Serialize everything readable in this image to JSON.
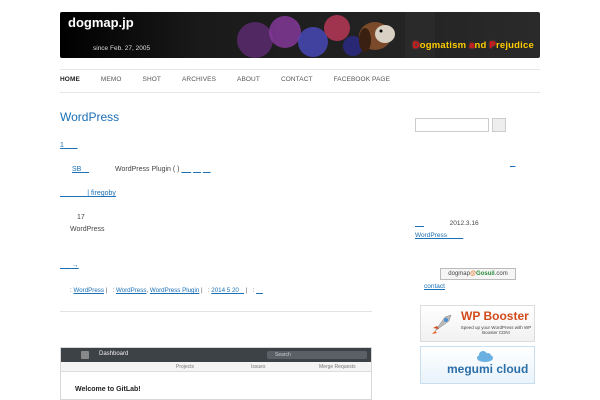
{
  "header": {
    "site_title": "dogmap.jp",
    "since": "since Feb. 27, 2005",
    "tagline_parts": [
      "D",
      "ogmatism ",
      "a",
      "nd ",
      "P",
      "rejudice"
    ]
  },
  "nav": {
    "items": [
      "HOME",
      "MEMO",
      "SHOT",
      "ARCHIVES",
      "ABOUT",
      "CONTACT",
      "FACEBOOK PAGE"
    ]
  },
  "post": {
    "title": "WordPress",
    "link1": "1",
    "sb_link": "SB",
    "plugin_text": "WordPress Plugin  (     )",
    "author_link": "| firegoby",
    "number": "17",
    "wp_text": "WordPress",
    "more_link": "→",
    "meta": {
      "label_prefix": ":",
      "cat1": "WordPress",
      "sep": "|",
      "tags_prefix": ":",
      "tag1": "WordPress",
      "tag2": "WordPress Plugin",
      "date": "2014 5 20",
      "comments_prefix": ":"
    }
  },
  "gitlab": {
    "dashboard": "Dashboard",
    "search_placeholder": "Search",
    "tabs": [
      "Projects",
      "Issues",
      "Merge Requests"
    ],
    "welcome": "Welcome to GitLab!"
  },
  "sidebar": {
    "date": "2012.3.16",
    "wp_link": "WordPress",
    "gosuil_prefix": "dogmap",
    "gosuil_brand": "Gosuil",
    "gosuil_suffix": ".com",
    "contact": "contact",
    "wpbooster_title": "WP Booster",
    "wpbooster_sub": "Speed up your WordPress with WP Booster CDN!",
    "megumi_title": "megumi cloud"
  },
  "colors": {
    "link": "#1a6fb5",
    "wpbooster": "#d14a1a",
    "megumi": "#2c6fa8"
  }
}
